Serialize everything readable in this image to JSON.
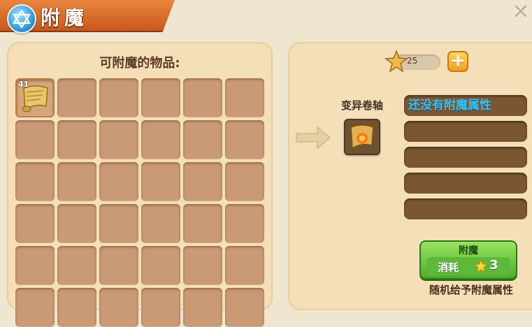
{
  "window": {
    "title": "附魔",
    "title_icon": "star-of-david-icon",
    "close_icon": "close-icon"
  },
  "left_panel": {
    "title": "可附魔的物品:",
    "items": [
      {
        "name": "scroll",
        "count": "41",
        "icon": "scroll-icon"
      }
    ],
    "visible_rows": 6,
    "columns": 6
  },
  "right_panel": {
    "currency": {
      "value": "25",
      "icon": "star-icon"
    },
    "add_button_icon": "plus-icon",
    "selected_item": {
      "name": "变异卷轴",
      "icon": "scroll-icon"
    },
    "attributes": [
      "还没有附魔属性",
      "",
      "",
      "",
      ""
    ],
    "enchant_button": {
      "label": "附魔",
      "cost_label": "消耗",
      "cost_value": "3"
    },
    "hint": "随机给予附魔属性"
  },
  "colors": {
    "title_bar": "#d66a2a",
    "panel": "#f4dfb8",
    "slot": "#c99a75",
    "attribute_text": "#3bc2f3",
    "button_green": "#4dae2a"
  }
}
